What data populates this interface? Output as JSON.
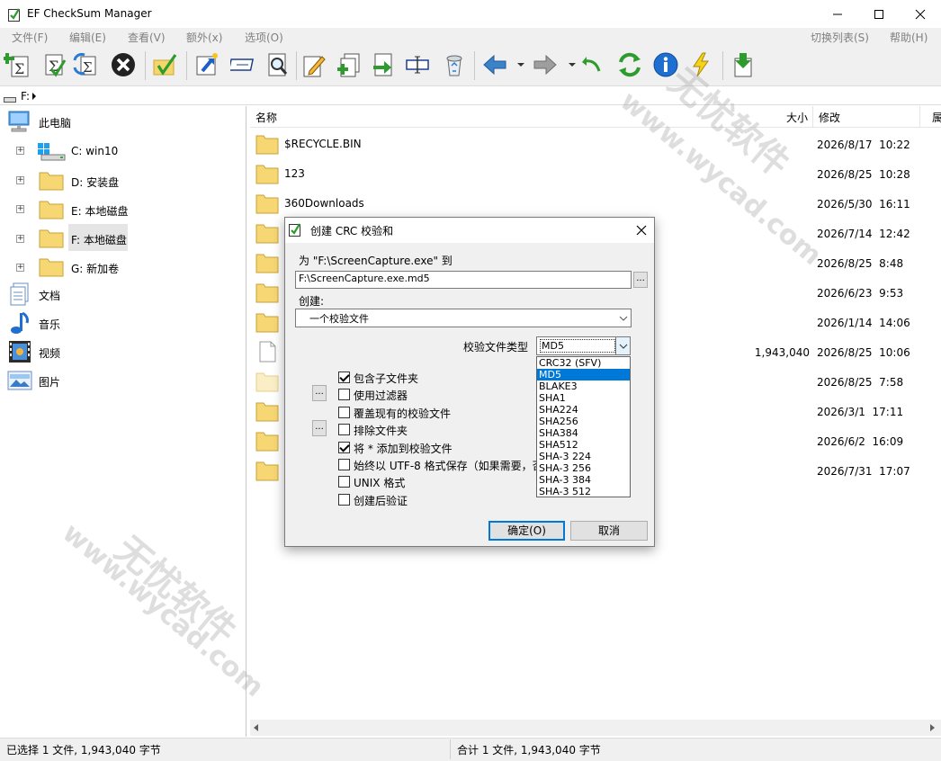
{
  "window": {
    "title": "EF CheckSum Manager"
  },
  "menu": [
    "文件(F)",
    "编辑(E)",
    "查看(V)",
    "额外(x)",
    "选项(O)"
  ],
  "menu_right": [
    "切换列表(S)",
    "帮助(H)"
  ],
  "address": "F:",
  "tree": {
    "root": "此电脑",
    "drives": [
      {
        "label": "C: win10"
      },
      {
        "label": "D: 安装盘"
      },
      {
        "label": "E: 本地磁盘"
      },
      {
        "label": "F: 本地磁盘"
      },
      {
        "label": "G: 新加卷"
      }
    ],
    "libraries": [
      "文档",
      "音乐",
      "视频",
      "图片"
    ]
  },
  "list": {
    "headers": {
      "name": "名称",
      "size": "大小",
      "modified": "修改",
      "extra": "属"
    },
    "rows": [
      {
        "name": "$RECYCLE.BIN",
        "size": "",
        "date": "2026/8/17  10:22",
        "type": "folder"
      },
      {
        "name": "123",
        "size": "",
        "date": "2026/8/25  10:28",
        "type": "folder"
      },
      {
        "name": "360Downloads",
        "size": "",
        "date": "2026/5/30  16:11",
        "type": "folder"
      },
      {
        "name": "",
        "size": "",
        "date": "2026/7/14  12:42",
        "type": "folder"
      },
      {
        "name": "",
        "size": "",
        "date": "2026/8/25  8:48",
        "type": "folder"
      },
      {
        "name": "",
        "size": "",
        "date": "2026/6/23  9:53",
        "type": "folder"
      },
      {
        "name": "",
        "size": "",
        "date": "2026/1/14  14:06",
        "type": "folder"
      },
      {
        "name": "",
        "size": "1,943,040",
        "date": "2026/8/25  10:06",
        "type": "file"
      },
      {
        "name": "",
        "size": "",
        "date": "2026/8/25  7:58",
        "type": "folder-light"
      },
      {
        "name": "",
        "size": "",
        "date": "2026/3/1  17:11",
        "type": "folder"
      },
      {
        "name": "",
        "size": "",
        "date": "2026/6/2  16:09",
        "type": "folder"
      },
      {
        "name": "",
        "size": "",
        "date": "2026/7/31  17:07",
        "type": "folder"
      }
    ]
  },
  "status": {
    "left": "已选择 1 文件, 1,943,040 字节",
    "right": "合计 1 文件, 1,943,040 字节"
  },
  "dialog": {
    "title": "创建 CRC 校验和",
    "for_label": "为 \"F:\\ScreenCapture.exe\" 到",
    "target_path": "F:\\ScreenCapture.exe.md5",
    "create_label": "创建:",
    "create_value": "一个校验文件",
    "type_label": "校验文件类型",
    "type_value": "MD5",
    "options": [
      {
        "label": "包含子文件夹",
        "checked": true
      },
      {
        "label": "使用过滤器",
        "checked": false
      },
      {
        "label": "覆盖现有的校验文件",
        "checked": false
      },
      {
        "label": "排除文件夹",
        "checked": false
      },
      {
        "label": "将 * 添加到校验文件",
        "checked": true
      },
      {
        "label": "始终以 UTF-8 格式保存（如果需要，否",
        "checked": false
      },
      {
        "label": "UNIX 格式",
        "checked": false
      },
      {
        "label": "创建后验证",
        "checked": false
      }
    ],
    "ok": "确定(O)",
    "cancel": "取消",
    "hash_types": [
      "CRC32 (SFV)",
      "MD5",
      "BLAKE3",
      "SHA1",
      "SHA224",
      "SHA256",
      "SHA384",
      "SHA512",
      "SHA-3 224",
      "SHA-3 256",
      "SHA-3 384",
      "SHA-3 512"
    ],
    "selected_index": 1
  },
  "watermark": {
    "brand": "无忧软件",
    "url": "www.wycad.com"
  }
}
